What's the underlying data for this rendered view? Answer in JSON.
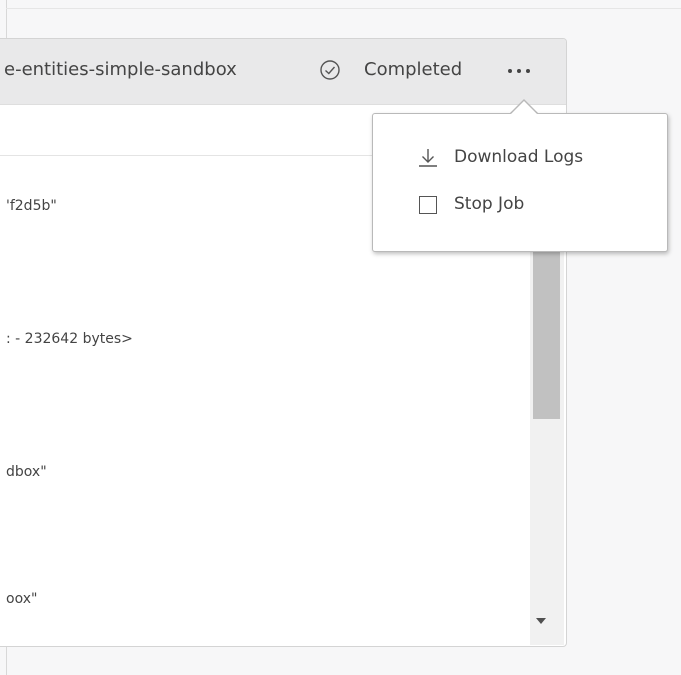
{
  "header": {
    "job_title": "e-entities-simple-sandbox",
    "status_label": "Completed",
    "status_icon": "check-circle-icon",
    "more_icon": "more-horizontal-icon"
  },
  "log": {
    "lines": [
      "'f2d5b\"",
      ": - 232642 bytes>",
      "dbox\"",
      "oox\""
    ]
  },
  "menu": {
    "items": [
      {
        "label": "Download Logs",
        "icon": "download-icon"
      },
      {
        "label": "Stop Job",
        "icon": "checkbox-icon"
      }
    ]
  },
  "colors": {
    "header_bg": "#e9e9ea",
    "text": "#444444",
    "scroll_thumb": "#c1c1c1"
  }
}
